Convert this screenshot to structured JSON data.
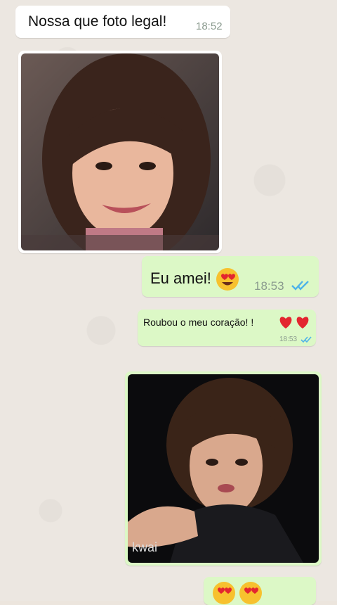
{
  "messages": {
    "m1": {
      "text": "Nossa que foto legal!",
      "time": "18:52"
    },
    "m2": {
      "text": "Eu amei!",
      "time": "18:53"
    },
    "m3": {
      "text": "Roubou o meu coração! !",
      "time": "18:53"
    },
    "photo2": {
      "watermark": "kwai"
    }
  },
  "colors": {
    "incoming": "#ffffff",
    "outgoing": "#dcf8c6",
    "read_ticks": "#4fb3e8"
  },
  "icons": [
    "heart-eyes-emoji",
    "red-heart-emoji",
    "double-check-icon"
  ]
}
